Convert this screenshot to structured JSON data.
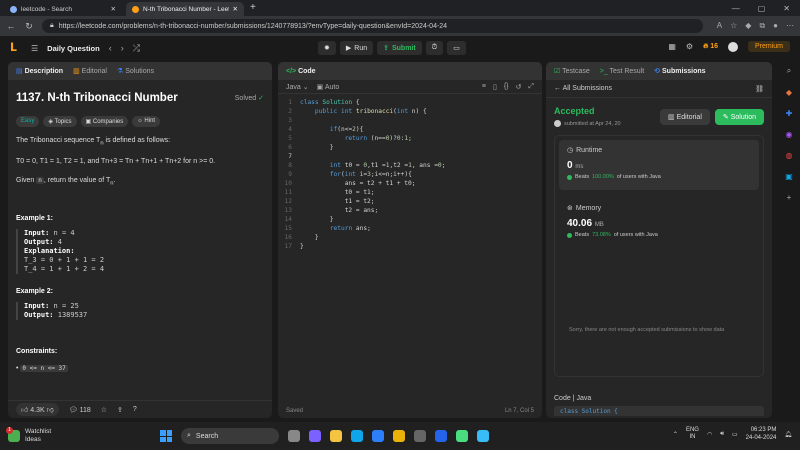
{
  "browser": {
    "tabs": [
      {
        "title": "leetcode - Search"
      },
      {
        "title": "N-th Tribonacci Number - LeetCo"
      }
    ],
    "url": "https://leetcode.com/problems/n-th-tribonacci-number/submissions/1240778913/?envType=daily-question&envId=2024-04-24"
  },
  "header": {
    "daily": "Daily Question",
    "run": "Run",
    "submit": "Submit",
    "streak": "16",
    "premium": "Premium"
  },
  "left": {
    "tabs": [
      "Description",
      "Editorial",
      "Solutions"
    ],
    "title": "1137. N-th Tribonacci Number",
    "solved": "Solved",
    "tags": [
      "Easy",
      "Topics",
      "Companies",
      "Hint"
    ],
    "intro": "The Tribonacci sequence T",
    "intro_sub": "n",
    "intro_end": " is defined as follows:",
    "formula": "T0 = 0, T1 = 1, T2 = 1, and Tn+3 = Tn + Tn+1 + Tn+2 for n >= 0.",
    "given_pre": "Given ",
    "given_code": "n",
    "given_post": ", return the value of T",
    "given_sub": "n",
    "given_end": ".",
    "ex1_title": "Example 1:",
    "ex1": {
      "input_label": "Input:",
      "input": " n = 4",
      "output_label": "Output:",
      "output": " 4",
      "expl_label": "Explanation:",
      "expl1": "T_3 = 0 + 1 + 1 = 2",
      "expl2": "T_4 = 1 + 1 + 2 = 4"
    },
    "ex2_title": "Example 2:",
    "ex2": {
      "input_label": "Input:",
      "input": " n = 25",
      "output_label": "Output:",
      "output": " 1389537"
    },
    "constraints_title": "Constraints:",
    "constraint1": "0 <= n <= 37",
    "likes": "4.3K",
    "comments": "118"
  },
  "mid": {
    "tab": "Code",
    "lang": "Java",
    "auto": "Auto",
    "status": "Saved",
    "cursor": "Ln 7, Col 5"
  },
  "right": {
    "tabs": [
      "Testcase",
      "Test Result",
      "Submissions"
    ],
    "back": "All Submissions",
    "accepted": "Accepted",
    "submitted": "submitted at Apr 24, 20",
    "editorial_btn": "Editorial",
    "solution_btn": "Solution",
    "runtime_label": "Runtime",
    "runtime_val": "0",
    "runtime_unit": "ms",
    "runtime_beats_pre": "Beats ",
    "runtime_beats": "100.00%",
    "runtime_beats_post": " of users with Java",
    "memory_label": "Memory",
    "memory_val": "40.06",
    "memory_unit": "MB",
    "memory_beats_pre": "Beats ",
    "memory_beats": "73.08%",
    "memory_beats_post": " of users with Java",
    "not_enough": "Sorry, there are not enough accepted submissions to show data",
    "code_label": "Code",
    "code_lang": "Java",
    "code_peek": "class Solution {"
  },
  "taskbar": {
    "weather1": "Watchlist",
    "weather2": "Ideas",
    "badge": "1",
    "search": "Search",
    "lang1": "ENG",
    "lang2": "IN",
    "time": "06:23 PM",
    "date": "24-04-2024"
  },
  "colors": {
    "accent": "#ffa116",
    "success": "#2cbb5d"
  }
}
